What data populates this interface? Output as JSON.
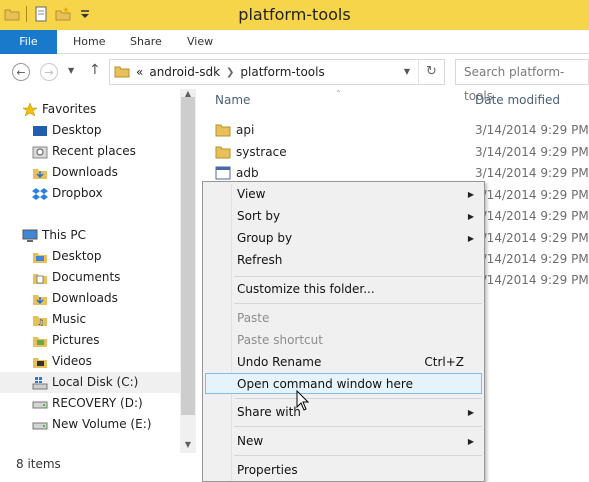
{
  "window": {
    "title": "platform-tools"
  },
  "ribbon": {
    "tabs": [
      "File",
      "Home",
      "Share",
      "View"
    ]
  },
  "address": {
    "overflow": "«",
    "crumbs": [
      "android-sdk",
      "platform-tools"
    ],
    "search_placeholder": "Search platform-tools"
  },
  "nav": {
    "favorites": "Favorites",
    "favorites_items": [
      "Desktop",
      "Recent places",
      "Downloads",
      "Dropbox"
    ],
    "thispc": "This PC",
    "thispc_items": [
      "Desktop",
      "Documents",
      "Downloads",
      "Music",
      "Pictures",
      "Videos",
      "Local Disk (C:)",
      "RECOVERY (D:)",
      "New Volume (E:)"
    ]
  },
  "files": {
    "col_name": "Name",
    "col_date": "Date modified",
    "rows": [
      {
        "name": "api",
        "date": "3/14/2014 9:29 PM"
      },
      {
        "name": "systrace",
        "date": "3/14/2014 9:29 PM"
      },
      {
        "name": "adb",
        "date": "3/14/2014 9:29 PM"
      },
      {
        "name": "",
        "date": "3/14/2014 9:29 PM"
      },
      {
        "name": "",
        "date": "3/14/2014 9:29 PM"
      },
      {
        "name": "",
        "date": "3/14/2014 9:29 PM"
      },
      {
        "name": "",
        "date": "3/14/2014 9:29 PM"
      },
      {
        "name": "",
        "date": "3/14/2014 9:29 PM"
      }
    ]
  },
  "status": {
    "count": "8 items"
  },
  "context_menu": {
    "view": "View",
    "sort_by": "Sort by",
    "group_by": "Group by",
    "refresh": "Refresh",
    "customize": "Customize this folder...",
    "paste": "Paste",
    "paste_shortcut": "Paste shortcut",
    "undo_rename": "Undo Rename",
    "undo_shortcut": "Ctrl+Z",
    "open_cmd": "Open command window here",
    "share_with": "Share with",
    "new": "New",
    "properties": "Properties"
  },
  "colors": {
    "titlebar": "#f7d54a",
    "file_tab": "#1979ca",
    "menu_highlight": "#e5f3fb",
    "folder": "#e8c05a"
  }
}
